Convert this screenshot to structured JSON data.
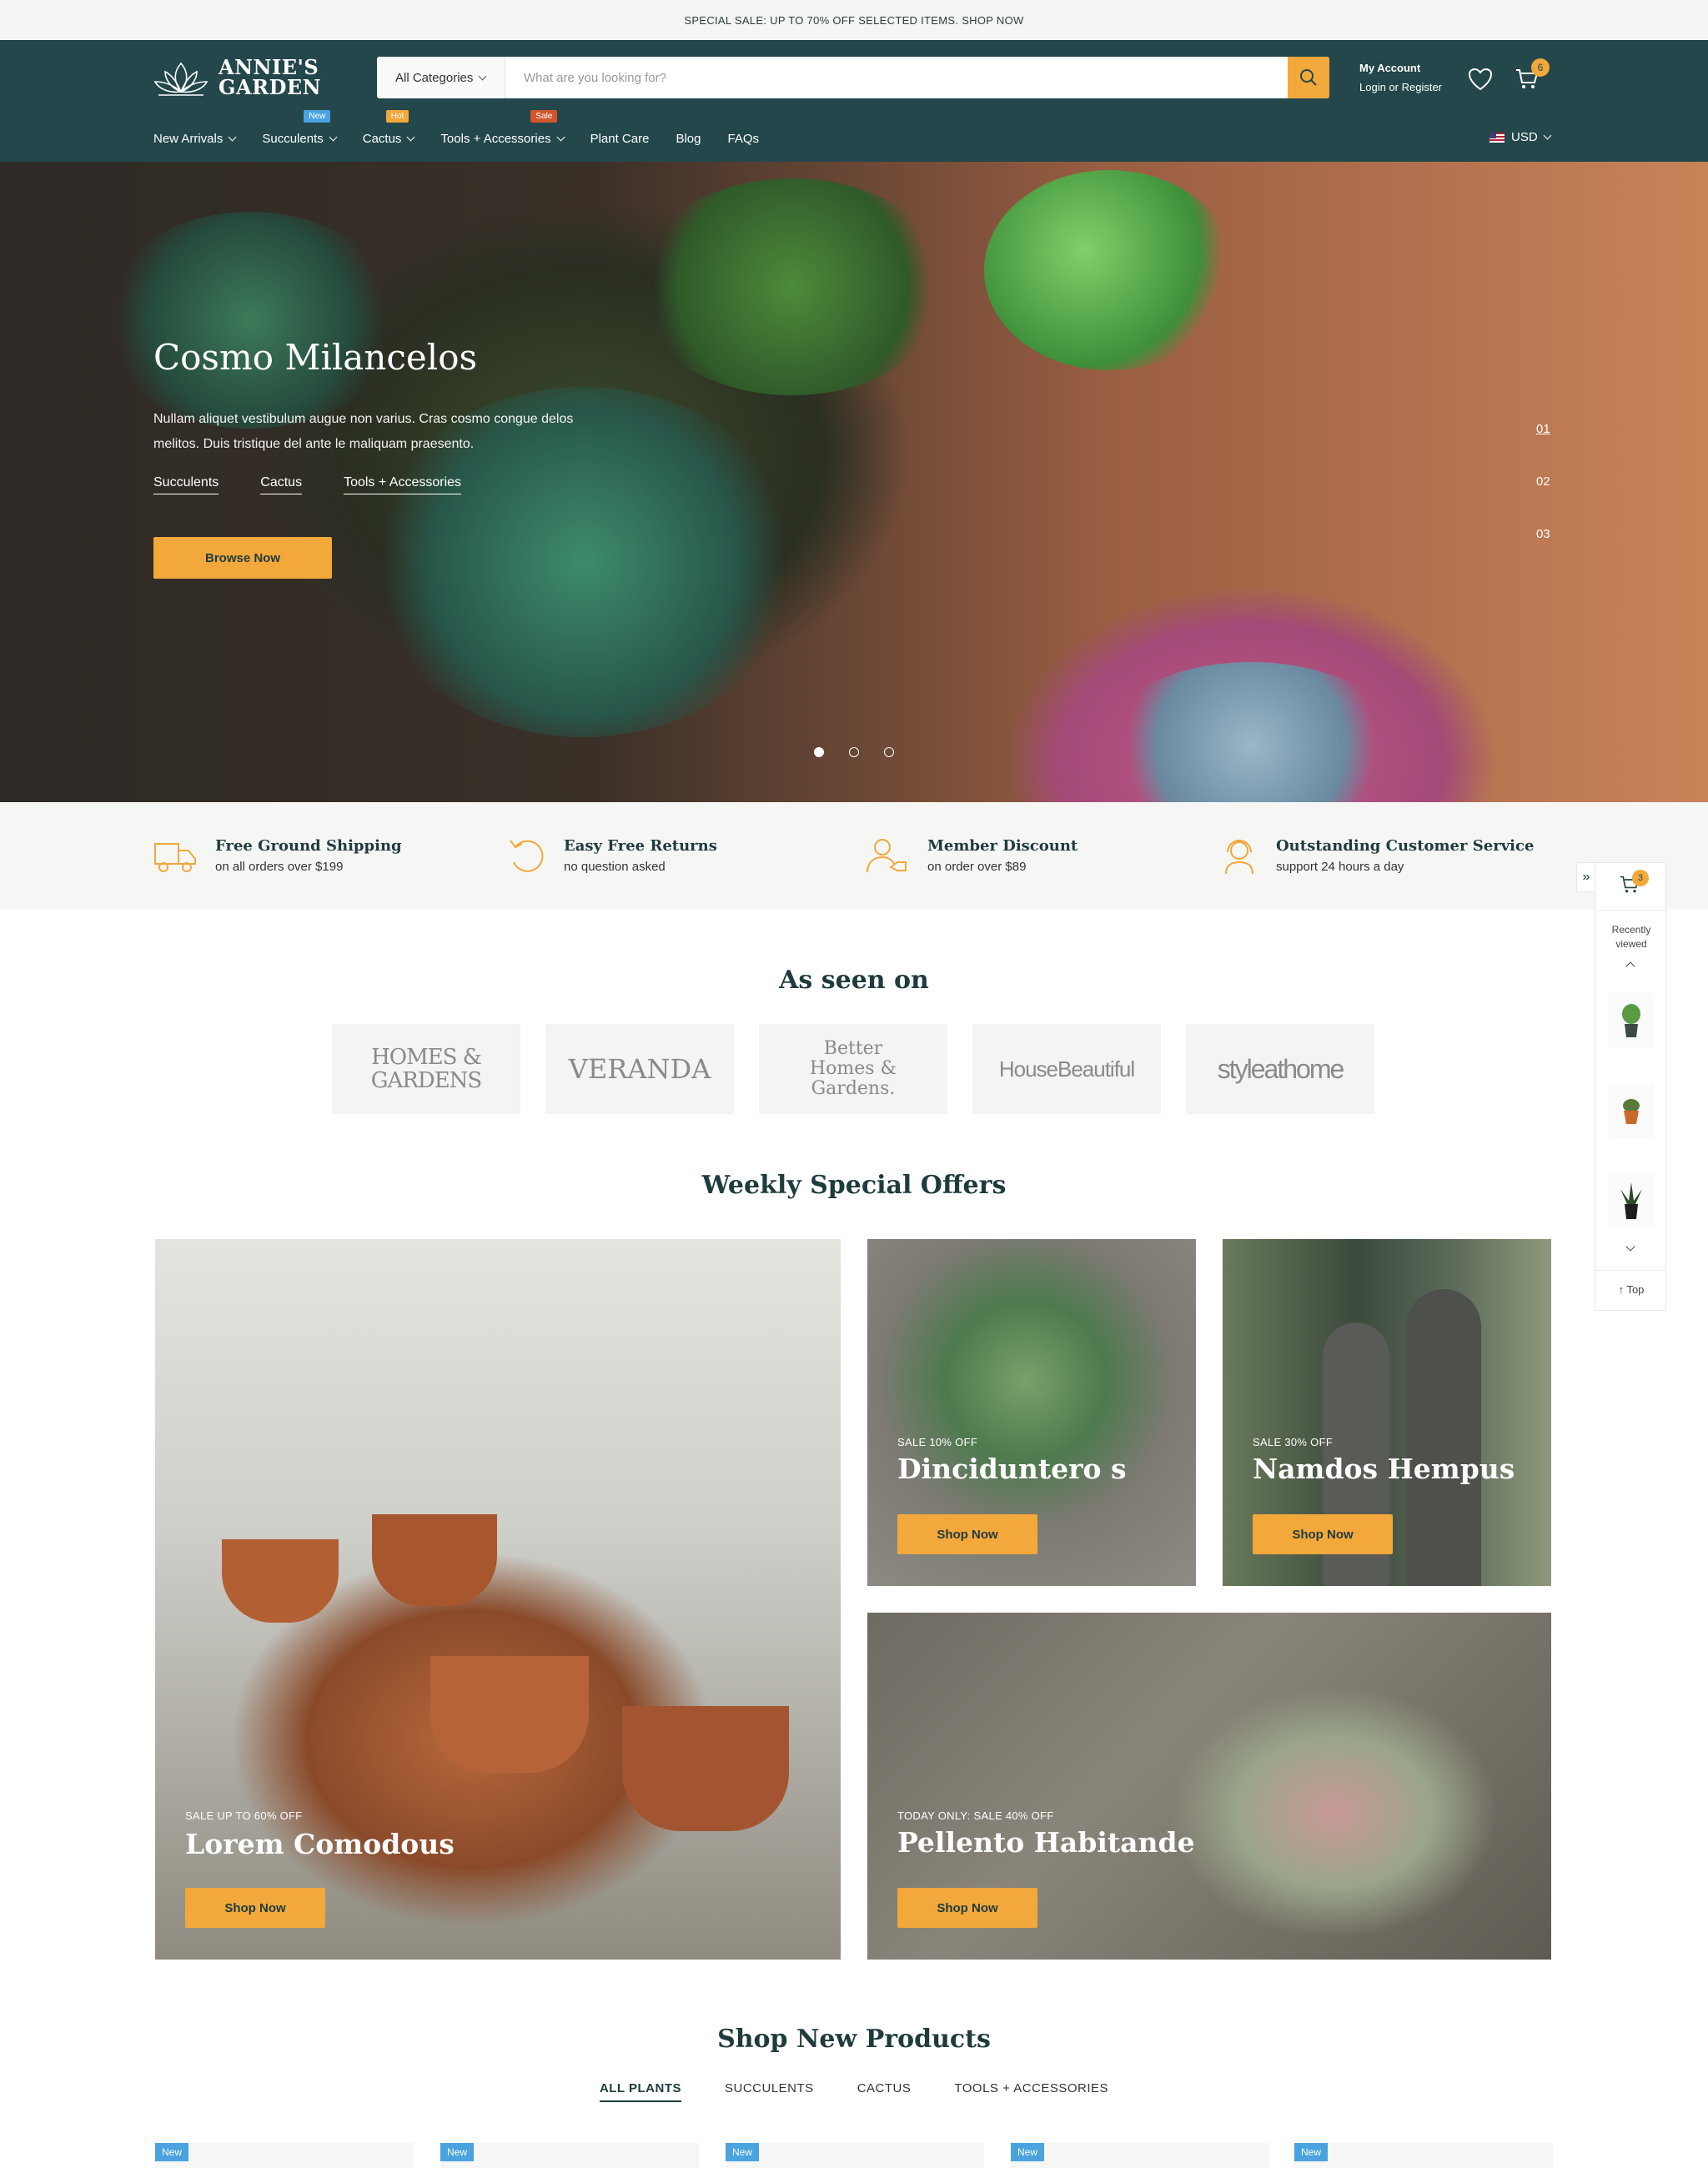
{
  "promo": {
    "text": "SPECIAL SALE: UP TO 70% OFF SELECTED ITEMS. SHOP NOW"
  },
  "brand": {
    "line1": "ANNIE'S",
    "line2": "GARDEN"
  },
  "search": {
    "category": "All Categories",
    "placeholder": "What are you looking for?"
  },
  "account": {
    "title": "My Account",
    "sub": "Login or Register"
  },
  "cart": {
    "count": "6"
  },
  "nav": {
    "items": [
      {
        "label": "New Arrivals",
        "dropdown": true
      },
      {
        "label": "Succulents",
        "dropdown": true,
        "badge": "New",
        "badge_color": "#4aa3df"
      },
      {
        "label": "Cactus",
        "dropdown": true,
        "badge": "Hot",
        "badge_color": "#f2a83b"
      },
      {
        "label": "Tools + Accessories",
        "dropdown": true,
        "badge": "Sale",
        "badge_color": "#d2562b"
      },
      {
        "label": "Plant Care",
        "dropdown": false
      },
      {
        "label": "Blog",
        "dropdown": false
      },
      {
        "label": "FAQs",
        "dropdown": false
      }
    ],
    "currency": "USD"
  },
  "hero": {
    "title": "Cosmo Milancelos",
    "description": "Nullam aliquet vestibulum augue non varius. Cras cosmo congue delos melitos. Duis tristique del ante le maliquam praesento.",
    "links": [
      "Succulents",
      "Cactus",
      "Tools + Accessories"
    ],
    "button": "Browse Now",
    "slides": [
      "01",
      "02",
      "03"
    ],
    "active_slide": 1
  },
  "features": [
    {
      "title": "Free Ground Shipping",
      "sub": "on all orders over $199",
      "icon": "truck-icon"
    },
    {
      "title": "Easy Free Returns",
      "sub": "no question asked",
      "icon": "return-icon"
    },
    {
      "title": "Member Discount",
      "sub": "on order over $89",
      "icon": "member-icon"
    },
    {
      "title": "Outstanding Customer Service",
      "sub": "support 24 hours a day",
      "icon": "support-icon"
    }
  ],
  "side_panel": {
    "cart_count": "3",
    "recent_label": "Recently viewed",
    "top_label": "Top"
  },
  "as_seen_on": {
    "title": "As seen on",
    "brands": [
      "HOMES & GARDENS",
      "VERANDA",
      "Better Homes & Gardens.",
      "HouseBeautiful",
      "styleathome"
    ]
  },
  "weekly": {
    "title": "Weekly Special Offers",
    "offers": [
      {
        "kicker": "SALE UP TO 60% OFF",
        "name": "Lorem Comodous",
        "button": "Shop Now"
      },
      {
        "kicker": "SALE 10% OFF",
        "name": "Dinciduntero s",
        "button": "Shop Now"
      },
      {
        "kicker": "SALE 30% OFF",
        "name": "Namdos Hempus",
        "button": "Shop Now"
      },
      {
        "kicker": "TODAY ONLY: SALE 40% OFF",
        "name": "Pellento Habitande",
        "button": "Shop Now"
      }
    ]
  },
  "shop_new": {
    "title": "Shop New Products",
    "tabs": [
      "ALL PLANTS",
      "SUCCULENTS",
      "CACTUS",
      "TOOLS + ACCESSORIES"
    ],
    "badge": "New"
  },
  "colors": {
    "header": "#23474b",
    "accent": "#f2a83b",
    "new": "#4aa3df",
    "hot": "#f2a83b",
    "sale": "#d2562b"
  }
}
